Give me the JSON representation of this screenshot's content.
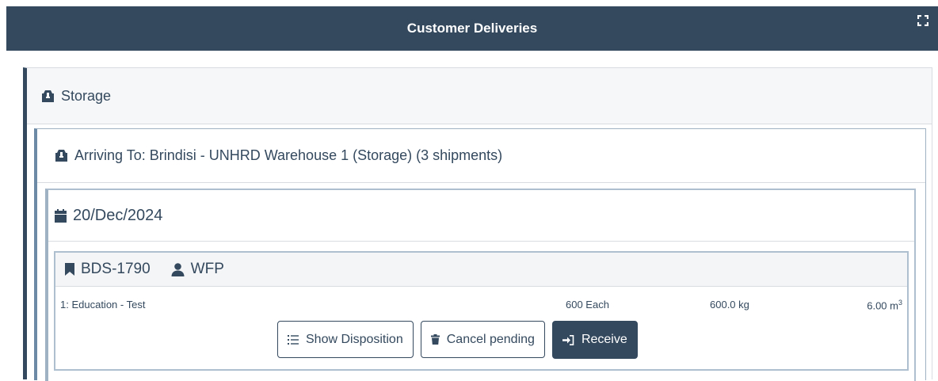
{
  "header": {
    "title": "Customer Deliveries",
    "fullscreen_icon": "expand-icon"
  },
  "storage": {
    "label": "Storage",
    "icon": "box-icon",
    "destination": {
      "label": "Arriving To: Brindisi - UNHRD Warehouse 1 (Storage) (3 shipments)",
      "icon": "box-icon",
      "date_group": {
        "date": "20/Dec/2024",
        "icon": "calendar-icon",
        "shipment": {
          "id": "BDS-1790",
          "id_icon": "bookmark-icon",
          "customer": "WFP",
          "customer_icon": "user-icon",
          "line": {
            "description": "1: Education - Test",
            "quantity": "600 Each",
            "weight": "600.0 kg",
            "volume": "6.00 m",
            "volume_unit_exp": "3"
          },
          "actions": {
            "show_disposition": "Show Disposition",
            "cancel_pending": "Cancel pending",
            "receive": "Receive"
          }
        }
      }
    }
  },
  "colors": {
    "header_bg": "#34495e",
    "primary": "#34495e",
    "border": "#aebfd0"
  }
}
